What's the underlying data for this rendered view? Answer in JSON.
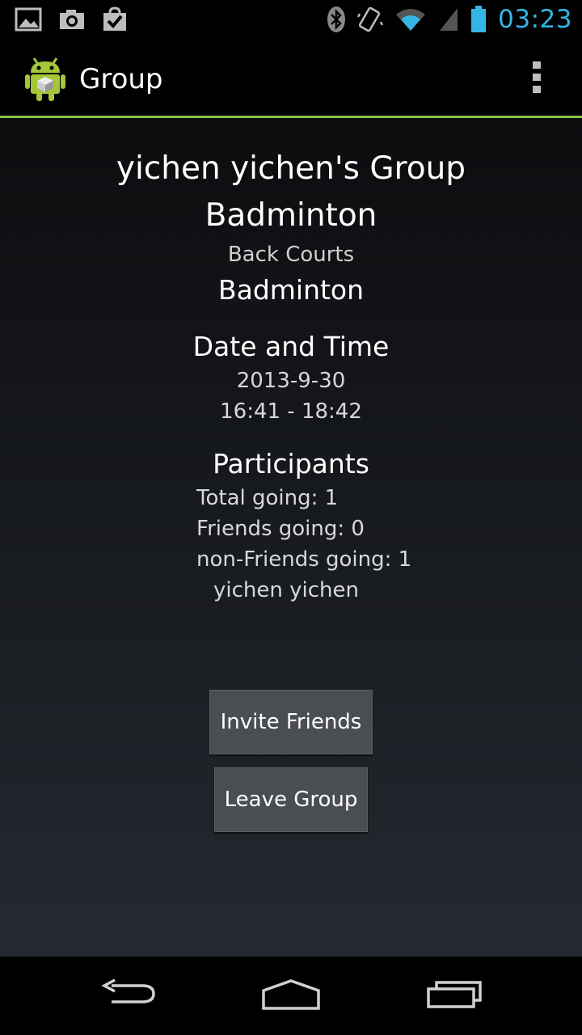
{
  "status_bar": {
    "time": "03:23",
    "time_color": "#33b5e5",
    "icons_left": [
      "gallery-icon",
      "camera-icon",
      "checkbox-bag-icon"
    ],
    "icons_right": [
      "bluetooth-icon",
      "vibrate-icon",
      "wifi-icon",
      "signal-icon",
      "battery-icon"
    ]
  },
  "action_bar": {
    "title": "Group",
    "accent": "#8bc34a"
  },
  "group": {
    "title": "yichen yichen's Group",
    "activity": "Badminton",
    "location": "Back Courts",
    "sport": "Badminton"
  },
  "date_time": {
    "heading": "Date and Time",
    "date": "2013-9-30",
    "time_range": "16:41 - 18:42"
  },
  "participants": {
    "heading": "Participants",
    "total": "Total going: 1",
    "friends": "Friends going: 0",
    "non_friends": "non-Friends going: 1",
    "names": [
      "yichen yichen"
    ]
  },
  "buttons": {
    "invite": "Invite Friends",
    "leave": "Leave Group"
  },
  "nav_bar": {
    "icons": [
      "back-icon",
      "home-icon",
      "recent-apps-icon"
    ]
  }
}
